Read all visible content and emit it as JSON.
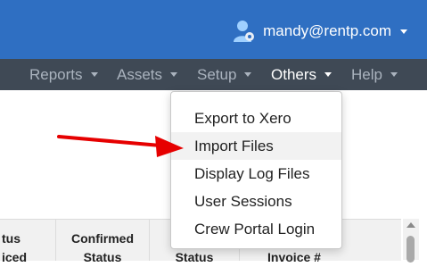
{
  "header": {
    "user_email": "mandy@rentp.com",
    "user_icon": "user-avatar-icon",
    "brand_color": "#2f6fc2"
  },
  "nav": {
    "items": [
      {
        "label": "Reports"
      },
      {
        "label": "Assets"
      },
      {
        "label": "Setup"
      },
      {
        "label": "Others",
        "active": true
      },
      {
        "label": "Help"
      }
    ],
    "bar_color": "#3f4955"
  },
  "dropdown": {
    "items": [
      {
        "label": "Export to Xero"
      },
      {
        "label": "Import Files",
        "highlighted": true
      },
      {
        "label": "Display Log Files"
      },
      {
        "label": "User Sessions"
      },
      {
        "label": "Crew Portal Login"
      }
    ]
  },
  "table": {
    "headers": [
      {
        "line1": "tus",
        "line2": "iced"
      },
      {
        "line1": "Confirmed",
        "line2": "Status"
      },
      {
        "line1": "",
        "line2": "Status"
      },
      {
        "line1": "",
        "line2": "Invoice #"
      }
    ]
  },
  "annotation": {
    "arrow_color": "#e60000"
  }
}
